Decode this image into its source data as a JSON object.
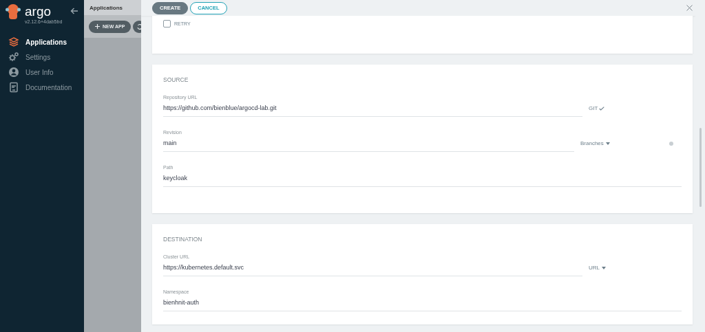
{
  "sidebar": {
    "logo_text": "argo",
    "version": "v2.12.6+4dab5bd",
    "items": [
      {
        "label": "Applications",
        "kind": "apps",
        "selected": true
      },
      {
        "label": "Settings",
        "kind": "settings",
        "selected": false
      },
      {
        "label": "User Info",
        "kind": "user",
        "selected": false
      },
      {
        "label": "Documentation",
        "kind": "docs",
        "selected": false
      }
    ]
  },
  "background_app": {
    "title": "Applications",
    "buttons": [
      {
        "kind": "new",
        "label": "NEW APP"
      },
      {
        "kind": "sync"
      }
    ]
  },
  "panel": {
    "buttons": [
      {
        "kind": "primary",
        "label": "CREATE"
      },
      {
        "kind": "outline",
        "label": "CANCEL"
      }
    ],
    "sync_options": [
      {
        "label": "RETRY",
        "checked": false
      }
    ],
    "sections": [
      {
        "title": "SOURCE",
        "fields": [
          {
            "label": "Repository URL",
            "value": "https://github.com/bienblue/argocd-lab.git",
            "side": {
              "kind": "check",
              "label": "GIT"
            }
          },
          {
            "label": "Revision",
            "value": "main",
            "side": {
              "kind": "dropdown",
              "label": "Branches"
            },
            "help": true
          },
          {
            "label": "Path",
            "value": "keycloak"
          }
        ]
      },
      {
        "title": "DESTINATION",
        "fields": [
          {
            "label": "Cluster URL",
            "value": "https://kubernetes.default.svc",
            "side": {
              "kind": "dropdown",
              "label": "URL"
            }
          },
          {
            "label": "Namespace",
            "value": "bienhnit-auth"
          }
        ]
      }
    ]
  }
}
